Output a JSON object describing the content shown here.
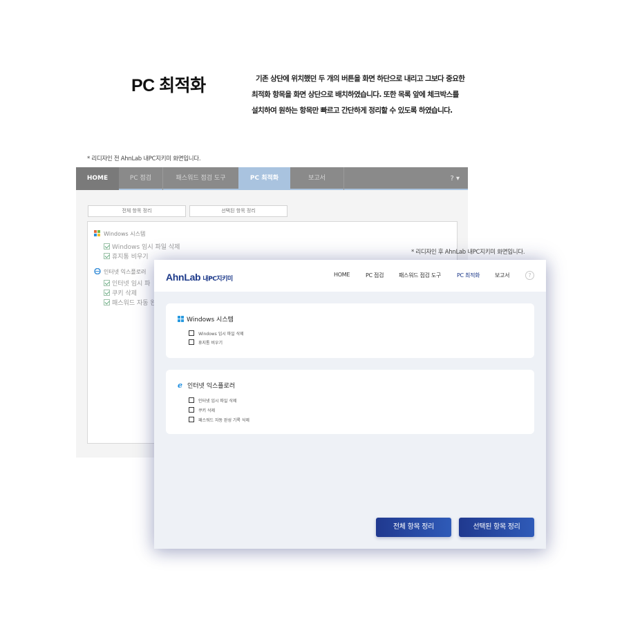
{
  "title": "PC 최적화",
  "description": [
    "기존 상단에 위치했던 두 개의 버튼을 화면 하단으로 내리고 그보다 중요한",
    "최적화 항목을 화면 상단으로 배치하였습니다. 또한 목록 앞에 체크박스를",
    "설치하여 원하는 항목만 빠르고 간단하게 정리할 수 있도록 하였습니다."
  ],
  "before": {
    "caption": "* 리디자인 전 AhnLab 내PC지키미 화면입니다.",
    "nav": {
      "tabs": [
        "HOME",
        "PC 점검",
        "패스워드 점검 도구",
        "PC 최적화",
        "보고서"
      ],
      "active_tab": "PC 최적화",
      "help": "? ▾"
    },
    "buttons": {
      "all": "전체 항목 정리",
      "selected": "선택된 항목 정리"
    },
    "groups": [
      {
        "title": "Windows 시스템",
        "icon": "windows-flag-icon",
        "items": [
          "Windows 임시 파일 삭제",
          "휴지통 비우기"
        ]
      },
      {
        "title": "인터넷 익스플로러",
        "icon": "ie-icon",
        "items": [
          "인터넷 임시 파",
          "쿠키 삭제",
          "패스워드 자동 완"
        ]
      }
    ]
  },
  "after": {
    "caption": "* 리디자인 후 AhnLab 내PC지키미 화면입니다.",
    "brand": {
      "logo": "AhnLab",
      "name": "내PC지키미"
    },
    "nav": {
      "items": [
        "HOME",
        "PC 점검",
        "패스워드 점검 도구",
        "PC 최적화",
        "보고서"
      ],
      "active": "PC 최적화",
      "help": "?"
    },
    "cards": [
      {
        "title": "Windows 시스템",
        "icon": "windows-icon",
        "items": [
          "Windows 임시 파일 삭제",
          "휴지통 비우기"
        ]
      },
      {
        "title": "인터넷 익스플로러",
        "icon": "ie-icon",
        "items": [
          "인터넷 임시 파일 삭제",
          "쿠키 삭제",
          "패스워드 자동 완성 기록 삭제"
        ]
      }
    ],
    "buttons": {
      "all": "전체 항목 정리",
      "selected": "선택된 항목 정리"
    }
  },
  "colors": {
    "accent": "#1d3a8a",
    "old_nav": "#8a8a8a",
    "old_active_tab": "#a9c3df",
    "new_bg": "#eef1f6"
  }
}
